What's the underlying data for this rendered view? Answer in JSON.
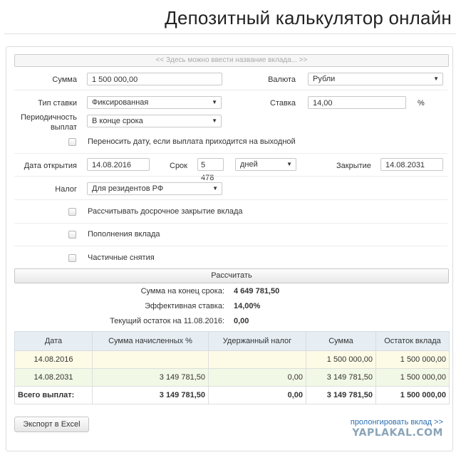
{
  "title": "Депозитный калькулятор онлайн",
  "name_placeholder": "<< Здесь можно ввести название вклада... >>",
  "form": {
    "sum_label": "Сумма",
    "sum_value": "1 500 000,00",
    "currency_label": "Валюта",
    "currency_value": "Рубли",
    "rate_type_label": "Тип ставки",
    "rate_type_value": "Фиксированная",
    "rate_label": "Ставка",
    "rate_value": "14,00",
    "rate_unit": "%",
    "period_label_1": "Периодичность",
    "period_label_2": "выплат",
    "period_value": "В конце срока",
    "move_date_label": "Переносить дату, если выплата приходится на выходной",
    "open_date_label": "Дата открытия",
    "open_date_value": "14.08.2016",
    "term_label": "Срок",
    "term_value": "5 478",
    "term_unit_value": "дней",
    "close_label": "Закрытие",
    "close_value": "14.08.2031",
    "tax_label": "Налог",
    "tax_value": "Для резидентов РФ",
    "early_close_label": "Рассчитывать досрочное закрытие вклада",
    "replenish_label": "Пополнения вклада",
    "partial_label": "Частичные снятия",
    "calc_button": "Рассчитать"
  },
  "summary": {
    "end_sum_label": "Сумма на конец срока:",
    "end_sum_value": "4 649 781,50",
    "eff_rate_label": "Эффективная ставка:",
    "eff_rate_value": "14,00%",
    "balance_label": "Текущий остаток на 11.08.2016:",
    "balance_value": "0,00"
  },
  "table": {
    "headers": [
      "Дата",
      "Сумма начисленных %",
      "Удержанный налог",
      "Сумма",
      "Остаток вклада"
    ],
    "rows": [
      [
        "14.08.2016",
        "",
        "",
        "1 500 000,00",
        "1 500 000,00"
      ],
      [
        "14.08.2031",
        "3 149 781,50",
        "0,00",
        "3 149 781,50",
        "1 500 000,00"
      ]
    ],
    "total": [
      "Всего выплат:",
      "3 149 781,50",
      "0,00",
      "3 149 781,50",
      "1 500 000,00"
    ]
  },
  "export_button": "Экспорт в Excel",
  "prolong_link": "пролонгировать вклад >>",
  "watermark": "YAPLAKAL.COM"
}
